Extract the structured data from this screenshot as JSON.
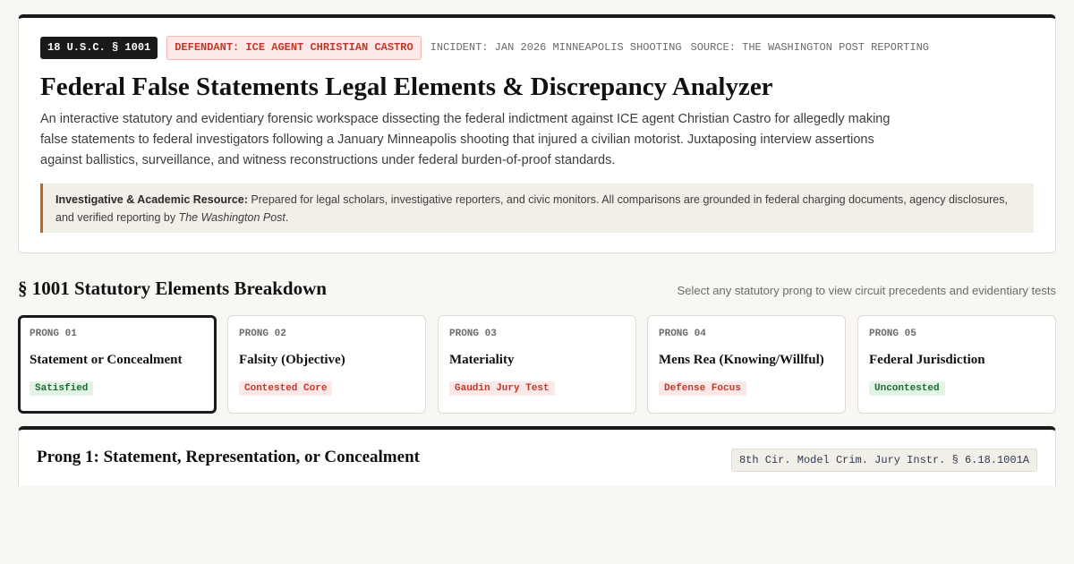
{
  "header": {
    "tag_statute": "18 U.S.C. § 1001",
    "tag_defendant": "DEFENDANT: ICE AGENT CHRISTIAN CASTRO",
    "tag_incident": "INCIDENT: JAN 2026 MINNEAPOLIS SHOOTING",
    "tag_source": "SOURCE: THE WASHINGTON POST REPORTING",
    "title": "Federal False Statements Legal Elements & Discrepancy Analyzer",
    "description": "An interactive statutory and evidentiary forensic workspace dissecting the federal indictment against ICE agent Christian Castro for allegedly making false statements to federal investigators following a January Minneapolis shooting that injured a civilian motorist. Juxtaposing interview assertions against ballistics, surveillance, and witness reconstructions under federal burden-of-proof standards.",
    "notice_label": "Investigative & Academic Resource:",
    "notice_text": " Prepared for legal scholars, investigative reporters, and civic monitors. All comparisons are grounded in federal charging documents, agency disclosures, and verified reporting by ",
    "notice_source": "The Washington Post",
    "notice_end": "."
  },
  "section": {
    "title": "§ 1001 Statutory Elements Breakdown",
    "hint": "Select any statutory prong to view circuit precedents and evidentiary tests"
  },
  "prongs": [
    {
      "num": "PRONG 01",
      "name": "Statement or Concealment",
      "status": "Satisfied",
      "status_color": "#1e6b34"
    },
    {
      "num": "PRONG 02",
      "name": "Falsity (Objective)",
      "status": "Contested Core",
      "status_color": "#c0392b"
    },
    {
      "num": "PRONG 03",
      "name": "Materiality",
      "status": "Gaudin Jury Test",
      "status_color": "#c0392b"
    },
    {
      "num": "PRONG 04",
      "name": "Mens Rea (Knowing/Willful)",
      "status": "Defense Focus",
      "status_color": "#c0392b"
    },
    {
      "num": "PRONG 05",
      "name": "Federal Jurisdiction",
      "status": "Uncontested",
      "status_color": "#1e6b34"
    }
  ],
  "detail": {
    "title": "Prong 1: Statement, Representation, or Concealment",
    "citation": "8th Cir. Model Crim. Jury Instr. § 6.18.1001A"
  }
}
